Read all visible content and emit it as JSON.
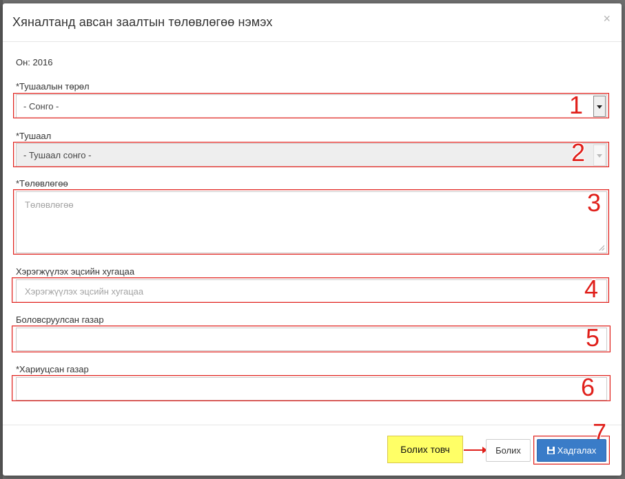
{
  "modal": {
    "title": "Хяналтанд авсан заалтын төлөвлөгөө нэмэх",
    "close": "×"
  },
  "form": {
    "year_label": "Он: 2016",
    "order_type": {
      "label": "*Тушаалын төрөл",
      "value": "- Сонго -"
    },
    "order": {
      "label": "*Тушаал",
      "value": "- Тушаал сонго -"
    },
    "plan": {
      "label": "*Төлөвлөгөө",
      "placeholder": "Төлөвлөгөө"
    },
    "deadline": {
      "label": "Хэрэгжүүлэх эцсийн хугацаа",
      "placeholder": "Хэрэгжүүлэх эцсийн хугацаа"
    },
    "prepared_by": {
      "label": "Боловсруулсан газар",
      "value": ""
    },
    "responsible": {
      "label": "*Хариуцсан газар",
      "value": ""
    }
  },
  "annotations": [
    "1",
    "2",
    "3",
    "4",
    "5",
    "6",
    "7"
  ],
  "callout": {
    "text": "Болих товч"
  },
  "footer": {
    "cancel_label": "Болих",
    "save_label": "Хадгалах",
    "save_icon": "floppy-disk-icon"
  },
  "colors": {
    "annotation": "#e0201b",
    "primary_button": "#3a7cc8",
    "callout_bg": "#ffff66"
  }
}
